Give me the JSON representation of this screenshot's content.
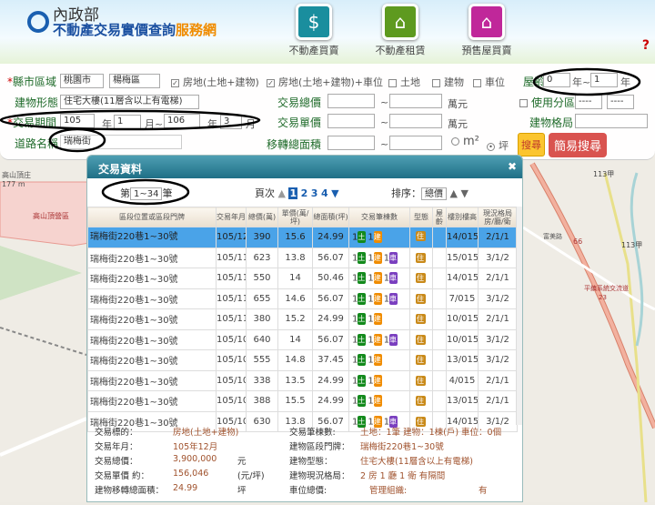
{
  "header": {
    "org": "內政部",
    "title_main": "不動產交易實價查詢",
    "title_accent": "服務網",
    "help": "?",
    "nav": [
      {
        "label": "不動產買賣",
        "icon": "house-dollar-icon",
        "color": "#1a8e9e"
      },
      {
        "label": "不動產租賃",
        "icon": "house-rent-icon",
        "color": "#5e9a1f"
      },
      {
        "label": "預售屋買賣",
        "icon": "crane-house-icon",
        "color": "#c0279a"
      }
    ]
  },
  "form": {
    "city_label": "縣市區域",
    "city": "桃園市",
    "district": "楊梅區",
    "types": [
      {
        "label": "房地(土地+建物)",
        "checked": true
      },
      {
        "label": "房地(土地+建物)+車位",
        "checked": true
      },
      {
        "label": "土地",
        "checked": false
      },
      {
        "label": "建物",
        "checked": false
      },
      {
        "label": "車位",
        "checked": false
      }
    ],
    "age_label": "屋齡",
    "age_from": "0",
    "age_to": "1",
    "year": "年",
    "dash": "年~",
    "building_type_label": "建物形態",
    "building_type": "住宅大樓(11層含以上有電梯)",
    "total_price_label": "交易總價",
    "unit_price_label": "交易單價",
    "wan": "萬元",
    "tilde": "~",
    "zoning_label": "使用分區",
    "zoning1": "----",
    "zoning2": "----",
    "layout_label": "建物格局",
    "period_label": "交易期間",
    "period_from_year": "105",
    "from_month": "1",
    "month_tilde": "月~",
    "period_to_year": "106",
    "to_month": "3",
    "month": "月",
    "road_label": "道路名稱",
    "road": "瑞梅街",
    "area_label": "移轉總面積",
    "unit_m2": "m²",
    "unit_ping": "坪",
    "search": "搜尋",
    "easy_search": "簡易搜尋"
  },
  "dialog": {
    "title": "交易資料",
    "close": "✖",
    "range_prefix": "第",
    "range": "1~34",
    "range_suffix": "筆",
    "page_label": "頁次",
    "pages": [
      "1",
      "2",
      "3",
      "4"
    ],
    "sort_label": "排序：",
    "sort": "總價",
    "columns": [
      "區段位置或區段門牌",
      "交易年月",
      "總價(萬)",
      "單價(萬/坪)",
      "總面積(坪)",
      "交易筆棟數",
      "型態",
      "屋齡",
      "樓別樓高",
      "現況格局房/廳/衛"
    ],
    "rows": [
      {
        "addr": "瑞梅街220巷1~30號",
        "ym": "105/12",
        "total": "390",
        "unit": "15.6",
        "area": "24.99",
        "park": false,
        "floor": "14/015",
        "layout": "2/1/1"
      },
      {
        "addr": "瑞梅街220巷1~30號",
        "ym": "105/11",
        "total": "623",
        "unit": "13.8",
        "area": "56.07",
        "park": true,
        "floor": "15/015",
        "layout": "3/1/2"
      },
      {
        "addr": "瑞梅街220巷1~30號",
        "ym": "105/11",
        "total": "550",
        "unit": "14",
        "area": "50.46",
        "park": true,
        "floor": "14/015",
        "layout": "2/1/1"
      },
      {
        "addr": "瑞梅街220巷1~30號",
        "ym": "105/11",
        "total": "655",
        "unit": "14.6",
        "area": "56.07",
        "park": true,
        "floor": "7/015",
        "layout": "3/1/2"
      },
      {
        "addr": "瑞梅街220巷1~30號",
        "ym": "105/11",
        "total": "380",
        "unit": "15.2",
        "area": "24.99",
        "park": false,
        "floor": "10/015",
        "layout": "2/1/1"
      },
      {
        "addr": "瑞梅街220巷1~30號",
        "ym": "105/10",
        "total": "640",
        "unit": "14",
        "area": "56.07",
        "park": true,
        "floor": "10/015",
        "layout": "3/1/2"
      },
      {
        "addr": "瑞梅街220巷1~30號",
        "ym": "105/10",
        "total": "555",
        "unit": "14.8",
        "area": "37.45",
        "park": false,
        "floor": "13/015",
        "layout": "3/1/2"
      },
      {
        "addr": "瑞梅街220巷1~30號",
        "ym": "105/10",
        "total": "338",
        "unit": "13.5",
        "area": "24.99",
        "park": false,
        "floor": "4/015",
        "layout": "2/1/1"
      },
      {
        "addr": "瑞梅街220巷1~30號",
        "ym": "105/10",
        "total": "388",
        "unit": "15.5",
        "area": "24.99",
        "park": false,
        "floor": "13/015",
        "layout": "2/1/1"
      },
      {
        "addr": "瑞梅街220巷1~30號",
        "ym": "105/10",
        "total": "630",
        "unit": "13.8",
        "area": "56.07",
        "park": true,
        "floor": "14/015",
        "layout": "3/1/2"
      }
    ],
    "tags": {
      "land": "土",
      "bldg": "建",
      "park": "車",
      "res": "住",
      "count": "1"
    },
    "detail": [
      {
        "k1": "交易標的：",
        "v1": "房地(土地+建物)",
        "u1": "",
        "k2": "交易筆棟數:",
        "v2": "土地：1筆 建物：1棟(戶) 車位：0個"
      },
      {
        "k1": "交易年月：",
        "v1": "105年12月",
        "u1": "",
        "k2": "建物區段門牌：",
        "v2": "瑞梅街220巷1~30號"
      },
      {
        "k1": "交易總價：",
        "v1": "3,900,000",
        "u1": "元",
        "k2": "建物型態：",
        "v2": "住宅大樓(11層含以上有電梯)"
      },
      {
        "k1": "交易單價 約：",
        "v1": "156,046",
        "u1": "(元/坪)",
        "k2": "建物現況格局：",
        "v2": "2 房 1 廳 1 衛 有隔間"
      },
      {
        "k1": "建物移轉總面積：",
        "v1": "24.99",
        "u1": "坪",
        "k2": "車位總價:",
        "v2": "管理組織:",
        "v3": "有"
      }
    ]
  },
  "map": {
    "labels": [
      "高山頂庄",
      "177 m",
      "高山頂營區",
      "113甲",
      "113甲",
      "66",
      "平鎮系統交流道",
      "23",
      "富美路"
    ]
  }
}
